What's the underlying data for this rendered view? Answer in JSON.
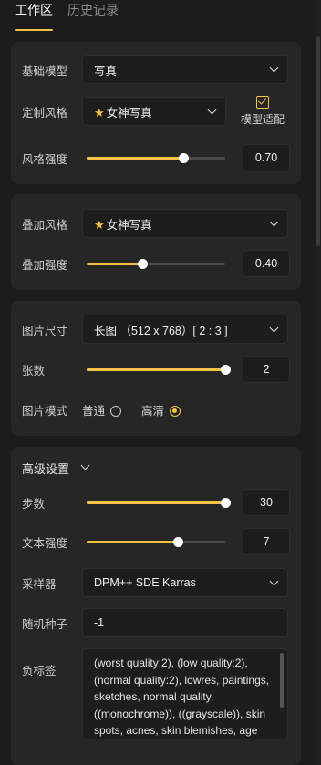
{
  "tabs": [
    {
      "label": "工作区",
      "active": true
    },
    {
      "label": "历史记录",
      "active": false
    }
  ],
  "card1": {
    "base_model_label": "基础模型",
    "base_model_value": "写真",
    "custom_style_label": "定制风格",
    "custom_style_value": "女神写真",
    "model_fit_label": "模型适配",
    "model_fit_checked": true,
    "style_strength_label": "风格强度",
    "style_strength_value": "0.70",
    "style_strength_fraction": 0.7
  },
  "card2": {
    "overlay_style_label": "叠加风格",
    "overlay_style_value": "女神写真",
    "overlay_strength_label": "叠加强度",
    "overlay_strength_value": "0.40",
    "overlay_strength_fraction": 0.4
  },
  "card3": {
    "image_size_label": "图片尺寸",
    "image_size_value": "长图 （512 x 768）[ 2 : 3 ]",
    "count_label": "张数",
    "count_value": "2",
    "count_fraction": 1.0,
    "image_mode_label": "图片模式",
    "mode_options": [
      {
        "label": "普通",
        "selected": false
      },
      {
        "label": "高清",
        "selected": true
      }
    ]
  },
  "card4": {
    "advanced_label": "高级设置",
    "steps_label": "步数",
    "steps_value": "30",
    "steps_fraction": 1.0,
    "text_strength_label": "文本强度",
    "text_strength_value": "7",
    "text_strength_fraction": 0.66,
    "sampler_label": "采样器",
    "sampler_value": "DPM++ SDE Karras",
    "seed_label": "随机种子",
    "seed_value": "-1",
    "negative_label": "负标签",
    "negative_value": "(worst quality:2), (low quality:2), (normal quality:2), lowres, paintings, sketches, normal quality, ((monochrome)), ((grayscale)), skin spots, acnes, skin blemishes, age"
  },
  "colors": {
    "accent": "#f3c445",
    "background": "#1c1c1c",
    "card": "#262626",
    "input": "#1d1d1d"
  }
}
